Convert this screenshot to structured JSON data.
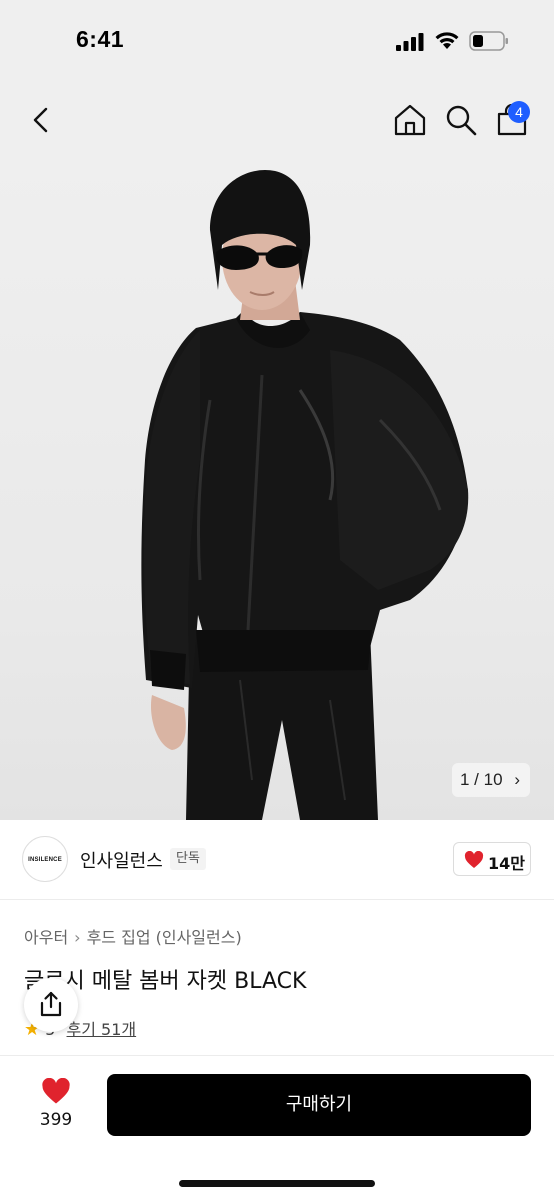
{
  "status_bar": {
    "time": "6:41"
  },
  "header": {
    "icons": [
      "back-chevron-icon",
      "home-icon",
      "search-icon",
      "shopping-bag-icon"
    ],
    "cart_count": "4",
    "accent_color": "#1f5eff"
  },
  "gallery": {
    "counter": "1 / 10",
    "chevron": "›"
  },
  "brand": {
    "logo_text": "INSILENCE",
    "name": "인사일런스",
    "tag": "단독",
    "likes": "14만"
  },
  "product": {
    "breadcrumb": [
      "아우터",
      "후드 집업 (인사일런스)"
    ],
    "breadcrumb_sep": "›",
    "title": "글로시 메탈 봄버 자켓 BLACK",
    "rating_star": "★",
    "rating_value": "5",
    "reviews": "후기 51개"
  },
  "bottom": {
    "wish_count": "399",
    "buy_label": "구매하기"
  }
}
